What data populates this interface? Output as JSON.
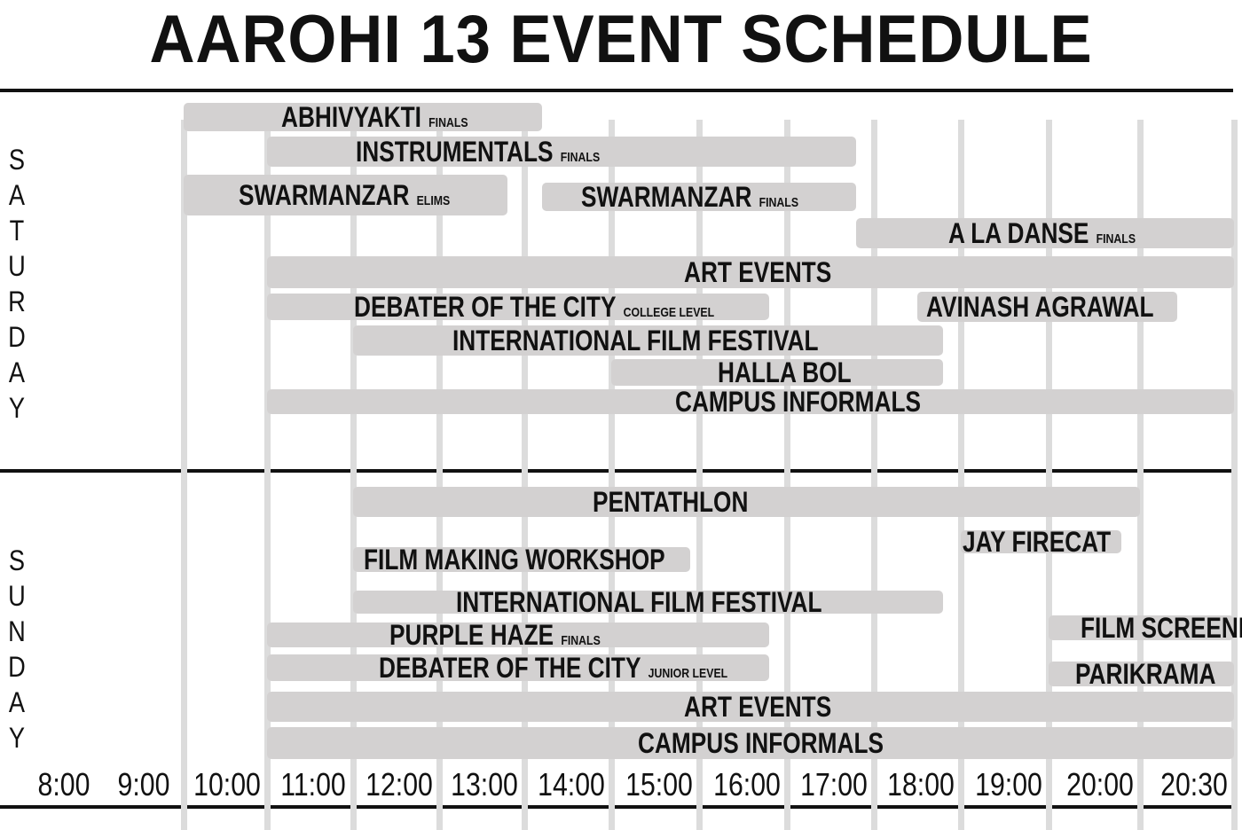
{
  "title": "AAROHI 13 EVENT SCHEDULE",
  "chart_data": {
    "type": "gantt",
    "x_unit": "hour",
    "x_range": [
      8,
      20.5
    ],
    "tick_labels": [
      "8:00",
      "9:00",
      "10:00",
      "11:00",
      "12:00",
      "13:00",
      "14:00",
      "15:00",
      "16:00",
      "17:00",
      "18:00",
      "19:00",
      "20:00",
      "20:30"
    ],
    "days": [
      {
        "label": "SATURDAY",
        "events": [
          {
            "name": "ABHIVYAKTI",
            "note": "FINALS",
            "start": 9.0,
            "end": 13.2
          },
          {
            "name": "INSTRUMENTALS",
            "note": "FINALS",
            "start": 10.0,
            "end": 16.8
          },
          {
            "name": "SWARMANZAR",
            "note": "ELIMS",
            "start": 9.0,
            "end": 12.8
          },
          {
            "name": "SWARMANZAR",
            "note": "FINALS",
            "start": 13.2,
            "end": 16.8
          },
          {
            "name": "A LA DANSE",
            "note": "FINALS",
            "start": 16.8,
            "end": 20.5
          },
          {
            "name": "ART EVENTS",
            "note": "",
            "start": 10.0,
            "end": 20.5
          },
          {
            "name": "DEBATER OF THE CITY",
            "note": "COLLEGE LEVEL",
            "start": 10.0,
            "end": 15.8
          },
          {
            "name": "AVINASH AGRAWAL",
            "note": "",
            "start": 17.5,
            "end": 20.2
          },
          {
            "name": "INTERNATIONAL FILM FESTIVAL",
            "note": "",
            "start": 11.0,
            "end": 17.8
          },
          {
            "name": "HALLA BOL",
            "note": "",
            "start": 14.0,
            "end": 17.8
          },
          {
            "name": "CAMPUS INFORMALS",
            "note": "",
            "start": 10.0,
            "end": 20.5
          }
        ]
      },
      {
        "label": "SUNDAY",
        "events": [
          {
            "name": "PENTATHLON",
            "note": "",
            "start": 11.0,
            "end": 20.0
          },
          {
            "name": "JAY FIRECAT",
            "note": "",
            "start": 18.0,
            "end": 19.8
          },
          {
            "name": "FILM MAKING WORKSHOP",
            "note": "",
            "start": 11.0,
            "end": 14.9
          },
          {
            "name": "INTERNATIONAL FILM FESTIVAL",
            "note": "",
            "start": 11.0,
            "end": 17.8
          },
          {
            "name": "FILM SCREENING",
            "note": "",
            "start": 19.0,
            "end": 20.5
          },
          {
            "name": "PURPLE HAZE",
            "note": "FINALS",
            "start": 10.0,
            "end": 15.8
          },
          {
            "name": "DEBATER OF THE CITY",
            "note": "JUNIOR LEVEL",
            "start": 10.0,
            "end": 15.8
          },
          {
            "name": "PARIKRAMA",
            "note": "",
            "start": 19.0,
            "end": 20.5
          },
          {
            "name": "ART EVENTS",
            "note": "",
            "start": 10.0,
            "end": 20.5
          },
          {
            "name": "CAMPUS INFORMALS",
            "note": "",
            "start": 10.0,
            "end": 20.5
          }
        ]
      }
    ]
  }
}
